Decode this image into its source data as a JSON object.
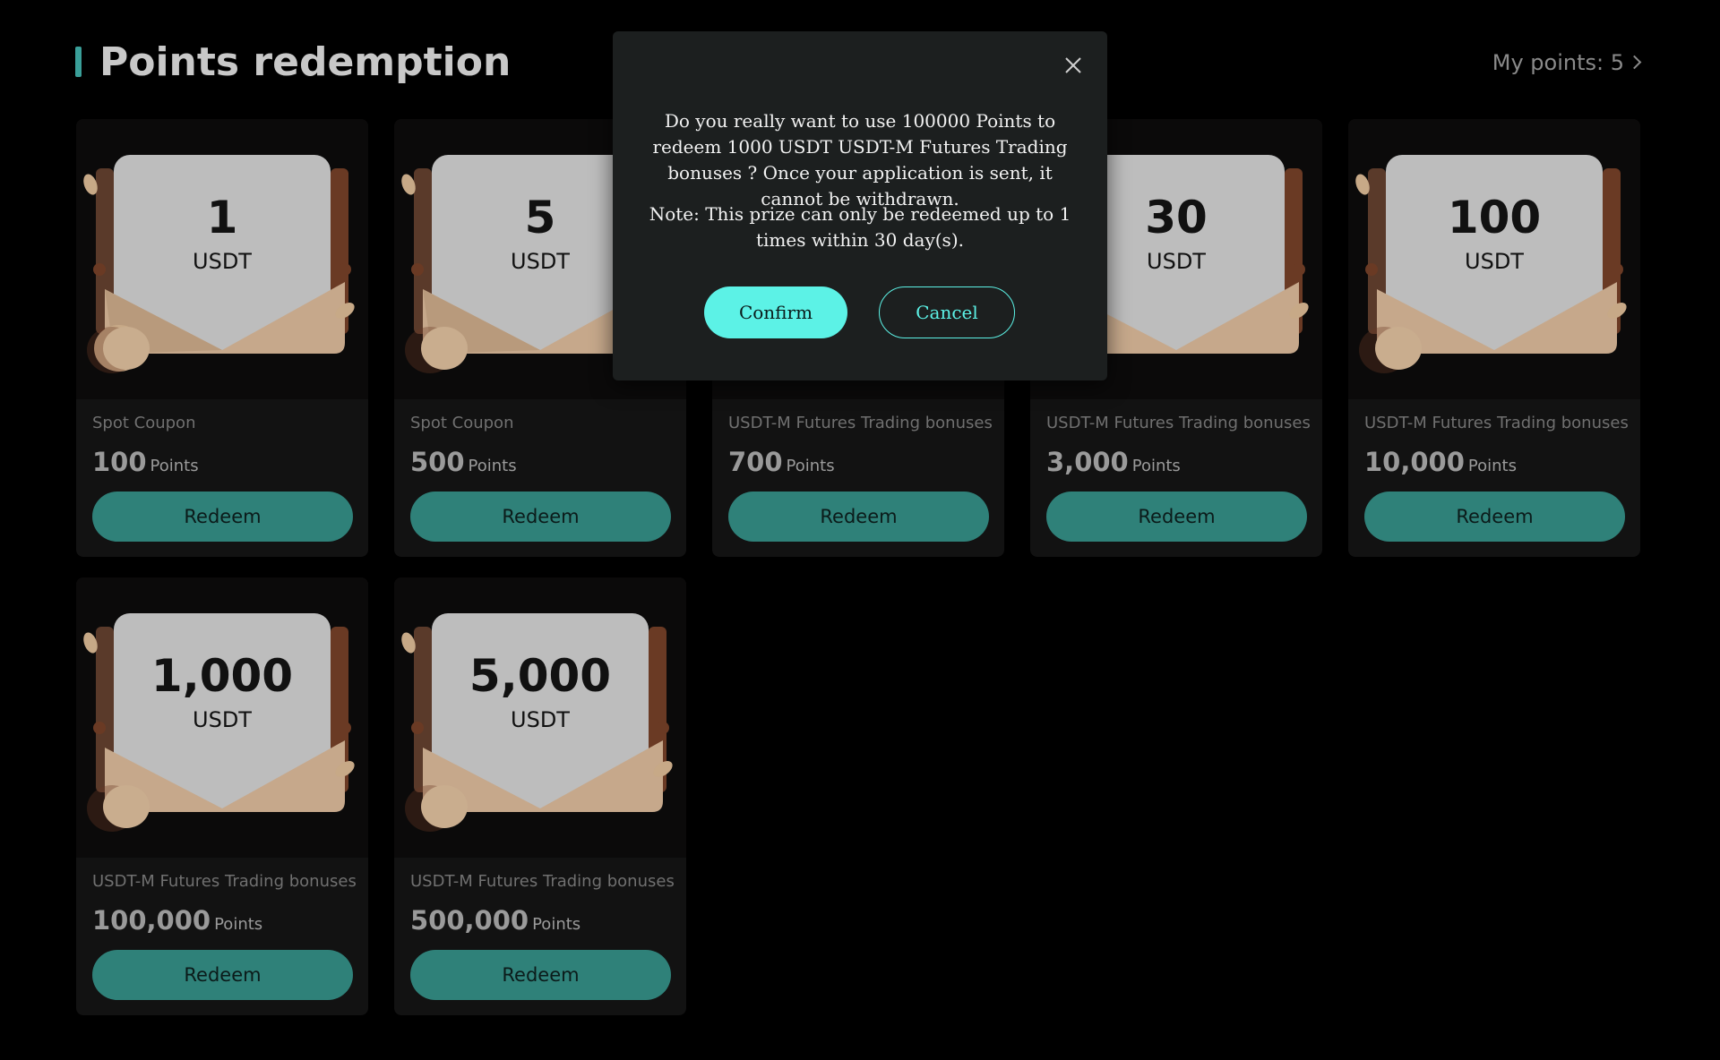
{
  "page": {
    "title": "Points redemption",
    "my_points_label": "My points: 5"
  },
  "colors": {
    "accent": "#5cf2e6",
    "redeem_button": "#2f8179",
    "background": "#000000",
    "card_background": "#121212",
    "modal_background": "#1c1f1f"
  },
  "cards": [
    {
      "amount": "1",
      "currency": "USDT",
      "type": "Spot Coupon",
      "cost": "100",
      "cost_unit": "Points",
      "button": "Redeem"
    },
    {
      "amount": "5",
      "currency": "USDT",
      "type": "Spot Coupon",
      "cost": "500",
      "cost_unit": "Points",
      "button": "Redeem"
    },
    {
      "amount": "",
      "currency": "",
      "type": "USDT-M Futures Trading bonuses",
      "cost": "700",
      "cost_unit": "Points",
      "button": "Redeem"
    },
    {
      "amount": "30",
      "currency": "USDT",
      "type": "USDT-M Futures Trading bonuses",
      "cost": "3,000",
      "cost_unit": "Points",
      "button": "Redeem"
    },
    {
      "amount": "100",
      "currency": "USDT",
      "type": "USDT-M Futures Trading bonuses",
      "cost": "10,000",
      "cost_unit": "Points",
      "button": "Redeem"
    },
    {
      "amount": "1,000",
      "currency": "USDT",
      "type": "USDT-M Futures Trading bonuses",
      "cost": "100,000",
      "cost_unit": "Points",
      "button": "Redeem"
    },
    {
      "amount": "5,000",
      "currency": "USDT",
      "type": "USDT-M Futures Trading bonuses",
      "cost": "500,000",
      "cost_unit": "Points",
      "button": "Redeem"
    }
  ],
  "modal": {
    "message": "Do you really want to use 100000 Points to redeem 1000 USDT USDT-M Futures Trading bonuses ? Once your application is sent, it cannot be withdrawn.",
    "note": "Note: This prize can only be redeemed up to 1 times within 30 day(s).",
    "confirm_label": "Confirm",
    "cancel_label": "Cancel",
    "close_icon": "close-icon"
  }
}
